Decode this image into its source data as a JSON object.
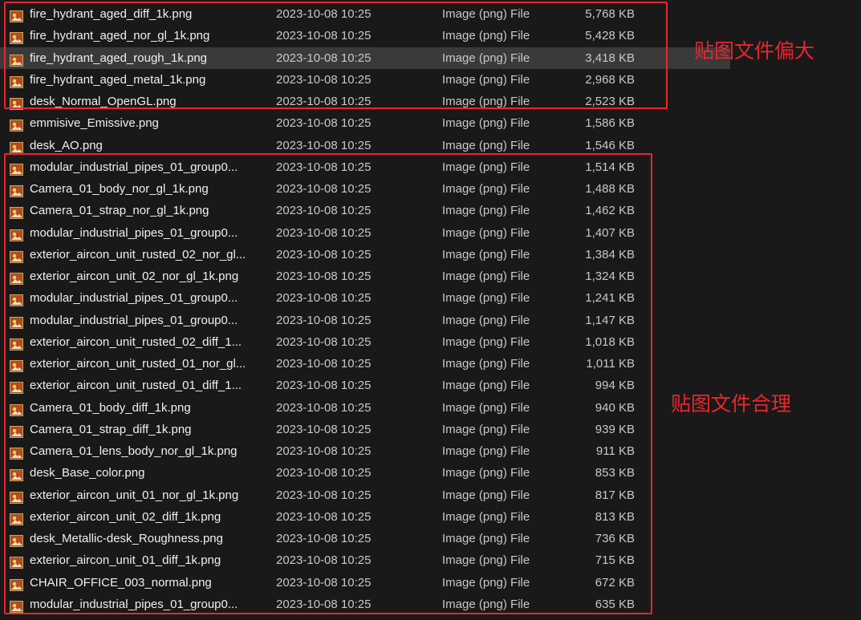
{
  "file_list": {
    "selected_index": 2,
    "files": [
      {
        "name": "fire_hydrant_aged_diff_1k.png",
        "date": "2023-10-08 10:25",
        "type": "Image (png) File",
        "size": "5,768 KB"
      },
      {
        "name": "fire_hydrant_aged_nor_gl_1k.png",
        "date": "2023-10-08 10:25",
        "type": "Image (png) File",
        "size": "5,428 KB"
      },
      {
        "name": "fire_hydrant_aged_rough_1k.png",
        "date": "2023-10-08 10:25",
        "type": "Image (png) File",
        "size": "3,418 KB"
      },
      {
        "name": "fire_hydrant_aged_metal_1k.png",
        "date": "2023-10-08 10:25",
        "type": "Image (png) File",
        "size": "2,968 KB"
      },
      {
        "name": "desk_Normal_OpenGL.png",
        "date": "2023-10-08 10:25",
        "type": "Image (png) File",
        "size": "2,523 KB"
      },
      {
        "name": "emmisive_Emissive.png",
        "date": "2023-10-08 10:25",
        "type": "Image (png) File",
        "size": "1,586 KB"
      },
      {
        "name": "desk_AO.png",
        "date": "2023-10-08 10:25",
        "type": "Image (png) File",
        "size": "1,546 KB"
      },
      {
        "name": "modular_industrial_pipes_01_group0...",
        "date": "2023-10-08 10:25",
        "type": "Image (png) File",
        "size": "1,514 KB"
      },
      {
        "name": "Camera_01_body_nor_gl_1k.png",
        "date": "2023-10-08 10:25",
        "type": "Image (png) File",
        "size": "1,488 KB"
      },
      {
        "name": "Camera_01_strap_nor_gl_1k.png",
        "date": "2023-10-08 10:25",
        "type": "Image (png) File",
        "size": "1,462 KB"
      },
      {
        "name": "modular_industrial_pipes_01_group0...",
        "date": "2023-10-08 10:25",
        "type": "Image (png) File",
        "size": "1,407 KB"
      },
      {
        "name": "exterior_aircon_unit_rusted_02_nor_gl...",
        "date": "2023-10-08 10:25",
        "type": "Image (png) File",
        "size": "1,384 KB"
      },
      {
        "name": "exterior_aircon_unit_02_nor_gl_1k.png",
        "date": "2023-10-08 10:25",
        "type": "Image (png) File",
        "size": "1,324 KB"
      },
      {
        "name": "modular_industrial_pipes_01_group0...",
        "date": "2023-10-08 10:25",
        "type": "Image (png) File",
        "size": "1,241 KB"
      },
      {
        "name": "modular_industrial_pipes_01_group0...",
        "date": "2023-10-08 10:25",
        "type": "Image (png) File",
        "size": "1,147 KB"
      },
      {
        "name": "exterior_aircon_unit_rusted_02_diff_1...",
        "date": "2023-10-08 10:25",
        "type": "Image (png) File",
        "size": "1,018 KB"
      },
      {
        "name": "exterior_aircon_unit_rusted_01_nor_gl...",
        "date": "2023-10-08 10:25",
        "type": "Image (png) File",
        "size": "1,011 KB"
      },
      {
        "name": "exterior_aircon_unit_rusted_01_diff_1...",
        "date": "2023-10-08 10:25",
        "type": "Image (png) File",
        "size": "994 KB"
      },
      {
        "name": "Camera_01_body_diff_1k.png",
        "date": "2023-10-08 10:25",
        "type": "Image (png) File",
        "size": "940 KB"
      },
      {
        "name": "Camera_01_strap_diff_1k.png",
        "date": "2023-10-08 10:25",
        "type": "Image (png) File",
        "size": "939 KB"
      },
      {
        "name": "Camera_01_lens_body_nor_gl_1k.png",
        "date": "2023-10-08 10:25",
        "type": "Image (png) File",
        "size": "911 KB"
      },
      {
        "name": "desk_Base_color.png",
        "date": "2023-10-08 10:25",
        "type": "Image (png) File",
        "size": "853 KB"
      },
      {
        "name": "exterior_aircon_unit_01_nor_gl_1k.png",
        "date": "2023-10-08 10:25",
        "type": "Image (png) File",
        "size": "817 KB"
      },
      {
        "name": "exterior_aircon_unit_02_diff_1k.png",
        "date": "2023-10-08 10:25",
        "type": "Image (png) File",
        "size": "813 KB"
      },
      {
        "name": "desk_Metallic-desk_Roughness.png",
        "date": "2023-10-08 10:25",
        "type": "Image (png) File",
        "size": "736 KB"
      },
      {
        "name": "exterior_aircon_unit_01_diff_1k.png",
        "date": "2023-10-08 10:25",
        "type": "Image (png) File",
        "size": "715 KB"
      },
      {
        "name": "CHAIR_OFFICE_003_normal.png",
        "date": "2023-10-08 10:25",
        "type": "Image (png) File",
        "size": "672 KB"
      },
      {
        "name": "modular_industrial_pipes_01_group0...",
        "date": "2023-10-08 10:25",
        "type": "Image (png) File",
        "size": "635 KB"
      }
    ]
  },
  "icons": {
    "file_icon": "png-image-file-icon"
  },
  "annotations": {
    "large_files": {
      "label": "贴图文件偏大",
      "color": "#e8262d"
    },
    "normal_files": {
      "label": "贴图文件合理",
      "color": "#e8262d"
    }
  },
  "colors": {
    "background": "#191919",
    "selected_row": "#3a3a3a",
    "text_primary": "#f0f0f0",
    "text_secondary": "#c8c8c8"
  }
}
